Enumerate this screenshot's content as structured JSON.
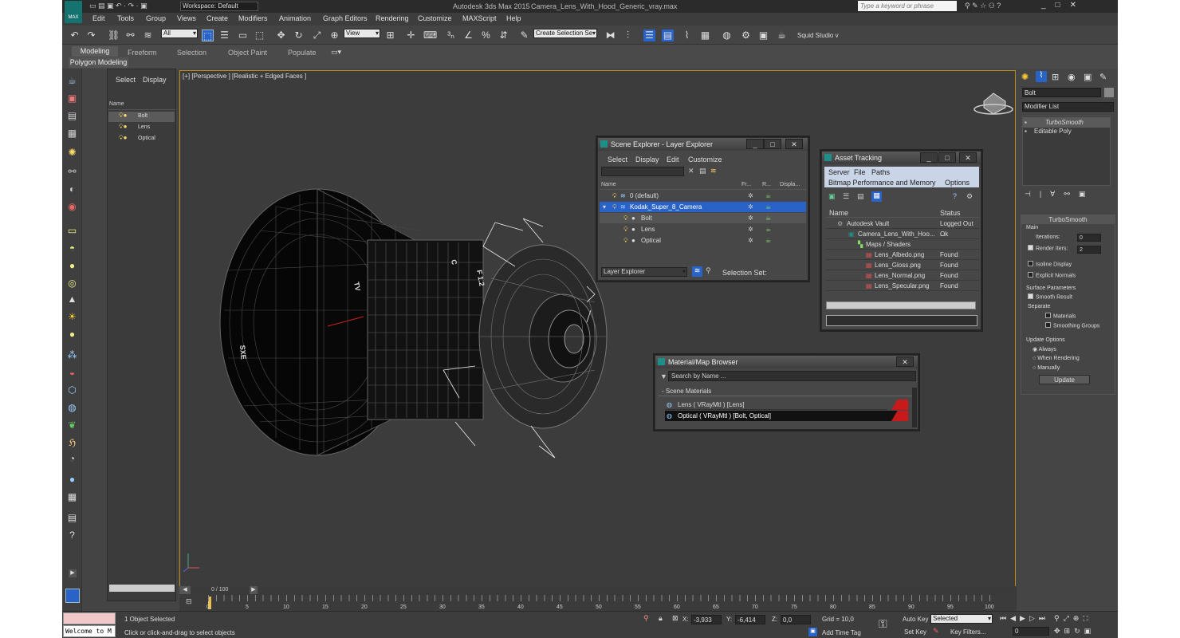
{
  "titlebar": {
    "app_title": "Autodesk 3ds Max  2015",
    "file_name": "Camera_Lens_With_Hood_Generic_vray.max",
    "workspace": "Workspace: Default",
    "search_placeholder": "Type a keyword or phrase",
    "logo_text": "MAX"
  },
  "menu": [
    "Edit",
    "Tools",
    "Group",
    "Views",
    "Create",
    "Modifiers",
    "Animation",
    "Graph Editors",
    "Rendering",
    "Customize",
    "MAXScript",
    "Help"
  ],
  "toolbar": {
    "selection_filter": "All",
    "ref_coord": "View",
    "named_selection": "Create Selection Se",
    "studio_label": "Squid Studio v"
  },
  "ribbon": {
    "tabs": [
      "Modeling",
      "Freeform",
      "Selection",
      "Object Paint",
      "Populate"
    ],
    "active_tab": "Modeling",
    "sub_label": "Polygon Modeling"
  },
  "scene_explorer_side": {
    "tabs": [
      "Select",
      "Display"
    ],
    "column_header": "Name",
    "items": [
      "Bolt",
      "Lens",
      "Optical"
    ],
    "selected": "Bolt"
  },
  "viewport": {
    "label": "[+] [Perspective ] [Realistic + Edged Faces ]"
  },
  "layer_explorer": {
    "title": "Scene Explorer - Layer Explorer",
    "menu": [
      "Select",
      "Display",
      "Edit",
      "Customize"
    ],
    "columns": [
      "Name",
      "Fr...",
      "R...",
      "Displa..."
    ],
    "rows": [
      {
        "name": "0 (default)",
        "level": 0
      },
      {
        "name": "Kodak_Super_8_Camera",
        "level": 0,
        "selected": true
      },
      {
        "name": "Bolt",
        "level": 1
      },
      {
        "name": "Lens",
        "level": 1
      },
      {
        "name": "Optical",
        "level": 1
      }
    ],
    "footer_left": "Layer Explorer",
    "footer_right": "Selection Set:"
  },
  "asset_tracking": {
    "title": "Asset Tracking",
    "menu": [
      "Server",
      "File",
      "Paths"
    ],
    "menu2": [
      "Bitmap Performance and Memory",
      "Options"
    ],
    "columns": [
      "Name",
      "Status"
    ],
    "rows": [
      {
        "name": "Autodesk Vault",
        "status": "Logged Out ...",
        "level": 0
      },
      {
        "name": "Camera_Lens_With_Hoo...",
        "status": "Ok",
        "level": 1
      },
      {
        "name": "Maps / Shaders",
        "status": "",
        "level": 2
      },
      {
        "name": "Lens_Albedo.png",
        "status": "Found",
        "level": 3
      },
      {
        "name": "Lens_Gloss.png",
        "status": "Found",
        "level": 3
      },
      {
        "name": "Lens_Normal.png",
        "status": "Found",
        "level": 3
      },
      {
        "name": "Lens_Specular.png",
        "status": "Found",
        "level": 3
      }
    ]
  },
  "material_browser": {
    "title": "Material/Map Browser",
    "search_placeholder": "Search by Name ...",
    "section": "- Scene Materials",
    "items": [
      "Lens  ( VRayMtl )  [Lens]",
      "Optical  ( VRayMtl )  [Bolt, Optical]"
    ]
  },
  "modify_panel": {
    "object_name": "Bolt",
    "modifier_list": "Modifier List",
    "stack": [
      "TurboSmooth",
      "Editable Poly"
    ],
    "rollout_title": "TurboSmooth",
    "main_label": "Main",
    "iterations_label": "Iterations:",
    "iterations": "0",
    "render_iters_label": "Render Iters:",
    "render_iters": "2",
    "isoline": "Isoline Display",
    "explicit": "Explicit Normals",
    "surface_params": "Surface Parameters",
    "smooth_result": "Smooth Result",
    "separate": "Separate",
    "materials": "Materials",
    "smoothing_groups": "Smoothing Groups",
    "update_options": "Update Options",
    "always": "Always",
    "when_rendering": "When Rendering",
    "manually": "Manually",
    "update_btn": "Update"
  },
  "timeline": {
    "frame": "0 / 100",
    "ticks": [
      "0",
      "5",
      "10",
      "15",
      "20",
      "25",
      "30",
      "35",
      "40",
      "45",
      "50",
      "55",
      "60",
      "65",
      "70",
      "75",
      "80",
      "85",
      "90",
      "95",
      "100"
    ]
  },
  "status": {
    "welcome": "Welcome to M",
    "selected": "1 Object Selected",
    "prompt": "Click or click-and-drag to select objects",
    "x_label": "X:",
    "x": "-3,933",
    "y_label": "Y:",
    "y": "-6,414",
    "z_label": "Z:",
    "z": "0,0",
    "grid": "Grid = 10,0",
    "add_time_tag": "Add Time Tag",
    "auto_key": "Auto Key",
    "set_key": "Set Key",
    "key_mode": "Selected",
    "key_filters": "Key Filters...",
    "frame_field": "0"
  },
  "colors": {
    "accent_blue": "#2a63c7",
    "viewport_border": "#b98e1a",
    "material_red": "#c81a1a"
  }
}
